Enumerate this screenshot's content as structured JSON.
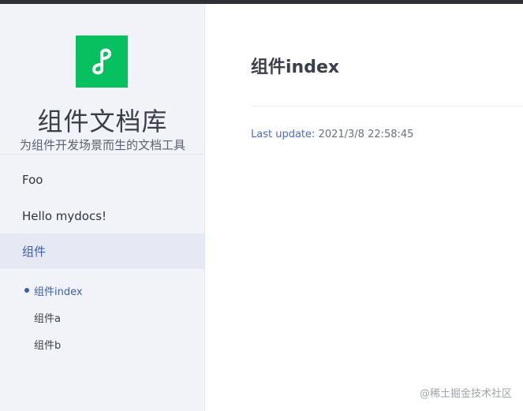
{
  "site": {
    "title": "组件文档库",
    "description": "为组件开发场景而生的文档工具",
    "logo_color": "#07c160"
  },
  "sidebar": {
    "items": [
      {
        "label": "Foo"
      },
      {
        "label": "Hello mydocs!"
      },
      {
        "label": "组件",
        "active": true
      }
    ],
    "subitems": [
      {
        "label": "组件index",
        "active": true
      },
      {
        "label": "组件a"
      },
      {
        "label": "组件b"
      }
    ]
  },
  "page": {
    "title": "组件index",
    "last_update_label": "Last update:",
    "last_update_value": "2021/3/8 22:58:45"
  },
  "watermark": "@稀土掘金技术社区",
  "colors": {
    "accent": "#3a5fb0",
    "sidebar_bg": "#f1f3f9"
  },
  "icons": {
    "logo": "mini-program-link-icon"
  }
}
